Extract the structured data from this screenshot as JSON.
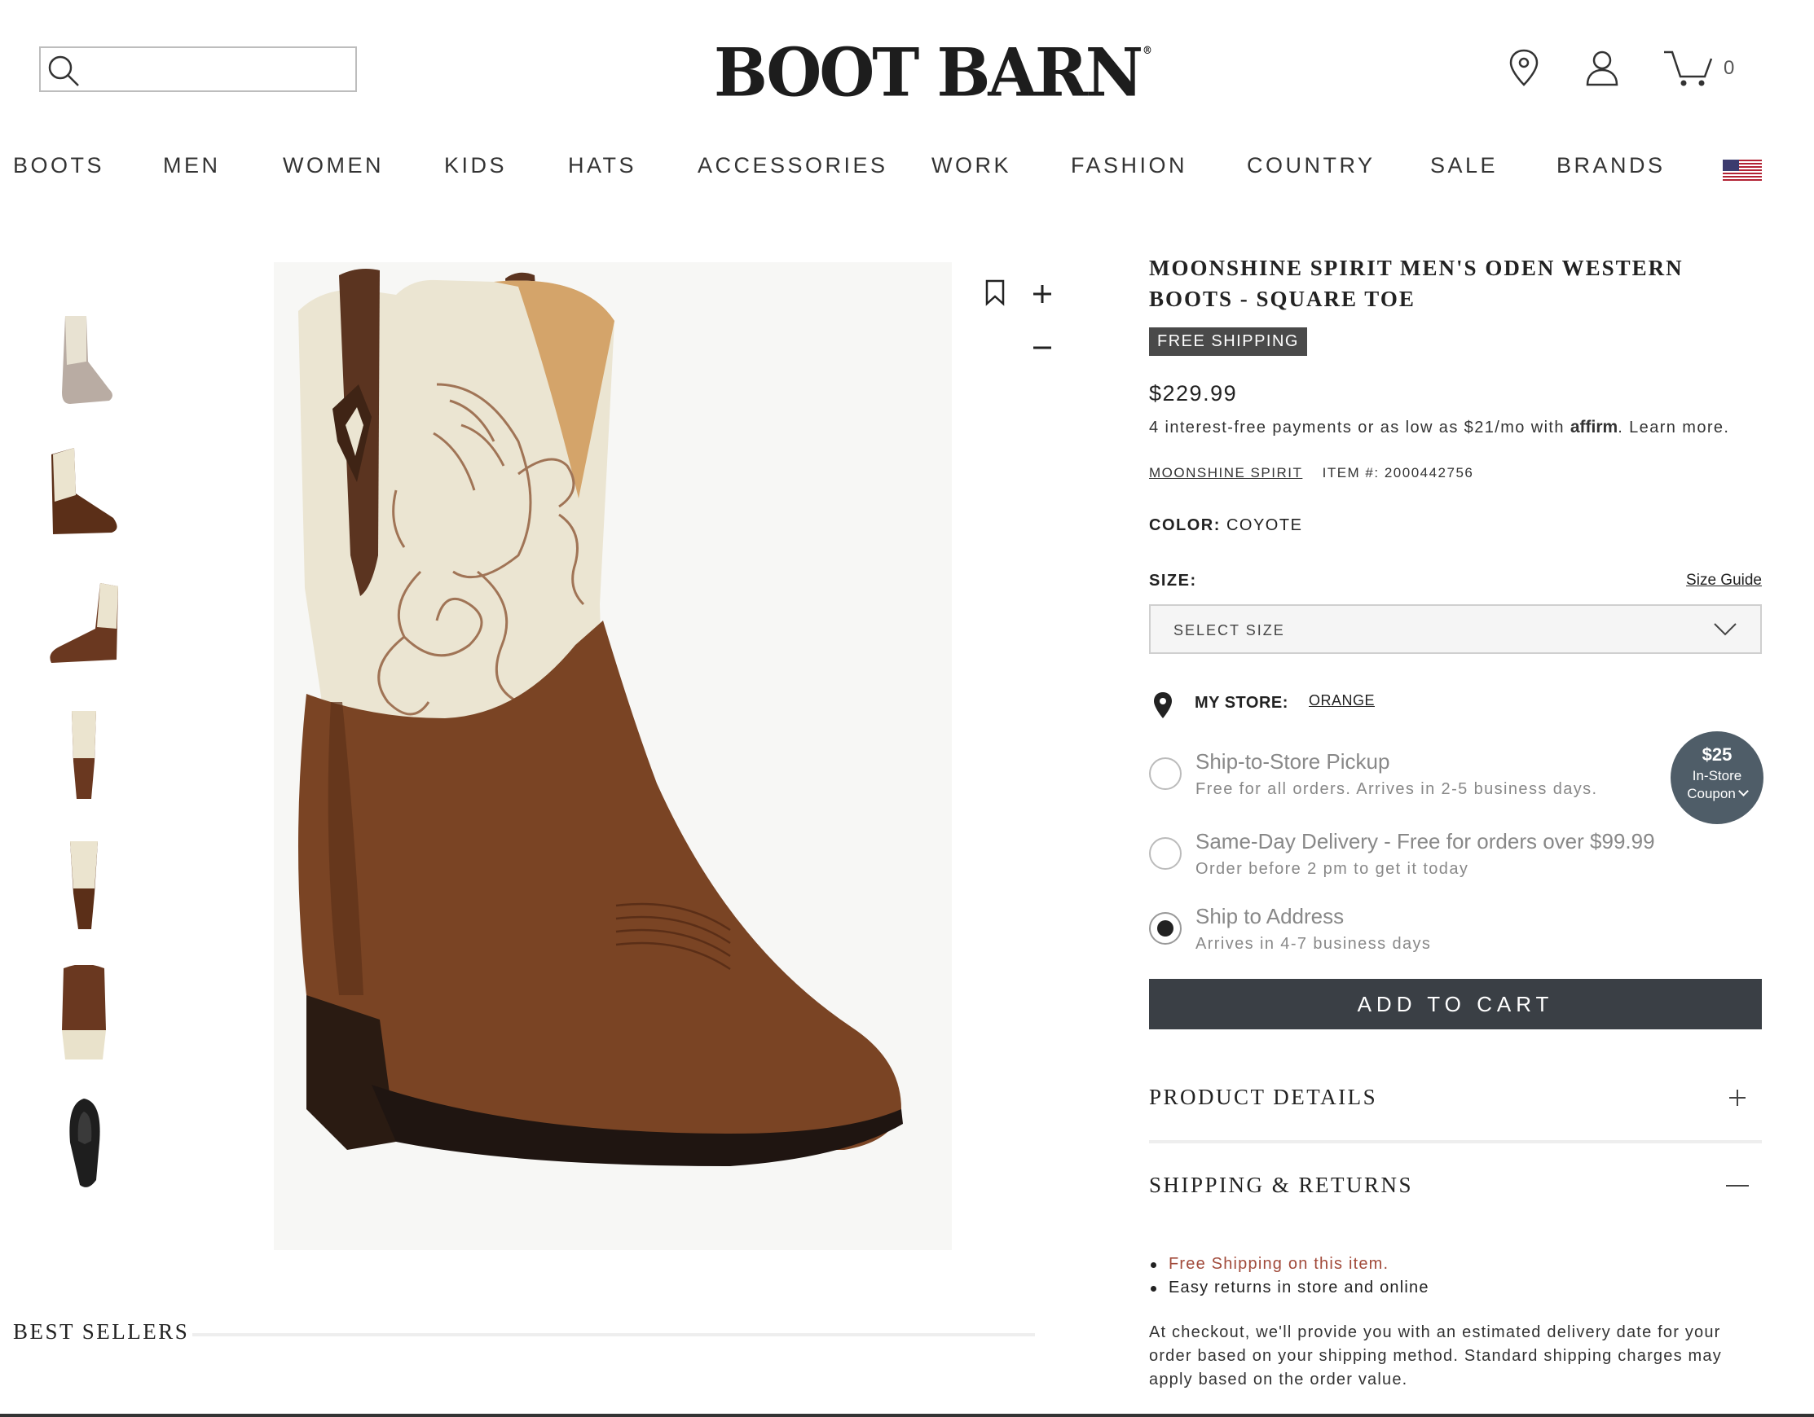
{
  "header": {
    "search_placeholder": "",
    "logo": "BOOT BARN",
    "logo_mark": "®",
    "cart_count": "0"
  },
  "nav": {
    "items": [
      "BOOTS",
      "MEN",
      "WOMEN",
      "KIDS",
      "HATS",
      "ACCESSORIES",
      "WORK",
      "FASHION",
      "COUNTRY",
      "SALE",
      "BRANDS"
    ]
  },
  "product": {
    "title": "MOONSHINE SPIRIT MEN'S ODEN WESTERN BOOTS - SQUARE TOE",
    "badge": "FREE SHIPPING",
    "price": "$229.99",
    "affirm_pre": "4 interest-free payments or as low as $21/mo with ",
    "affirm_brand": "affirm",
    "affirm_post": ". Learn more.",
    "brand": "MOONSHINE SPIRIT",
    "item_number": "ITEM #: 2000442756",
    "color_label": "COLOR:",
    "color_value": "COYOTE",
    "size_label": "SIZE:",
    "size_guide": "Size Guide",
    "size_placeholder": "SELECT SIZE",
    "store_label": "MY STORE:",
    "store_name": "ORANGE",
    "delivery_options": [
      {
        "title": "Ship-to-Store Pickup",
        "subtitle": "Free for all orders. Arrives in 2-5 business days.",
        "selected": false
      },
      {
        "title": "Same-Day Delivery - Free for orders over $99.99",
        "subtitle": "Order before 2 pm to get it today",
        "selected": false
      },
      {
        "title": "Ship to Address",
        "subtitle": "Arrives in 4-7 business days",
        "selected": true
      }
    ],
    "coupon": {
      "amount": "$25",
      "line2": "In-Store",
      "line3": "Coupon"
    },
    "add_to_cart": "ADD TO CART",
    "accordions": {
      "details": "PRODUCT DETAILS",
      "shipping": "SHIPPING & RETURNS"
    },
    "shipping_bullets": [
      "Free Shipping on this item.",
      "Easy returns in store and online"
    ],
    "shipping_text": "At checkout, we'll provide you with an estimated delivery date for your order based on your shipping method. Standard shipping charges may apply based on the order value."
  },
  "best_sellers": "BEST SELLERS",
  "colors": {
    "button_dark": "#3a3f45",
    "coupon": "#4f5d68",
    "badge": "#4a4a4a",
    "accent_red": "#a14a3a",
    "boot_leather": "#7a4424",
    "boot_shaft": "#ece6d3"
  }
}
